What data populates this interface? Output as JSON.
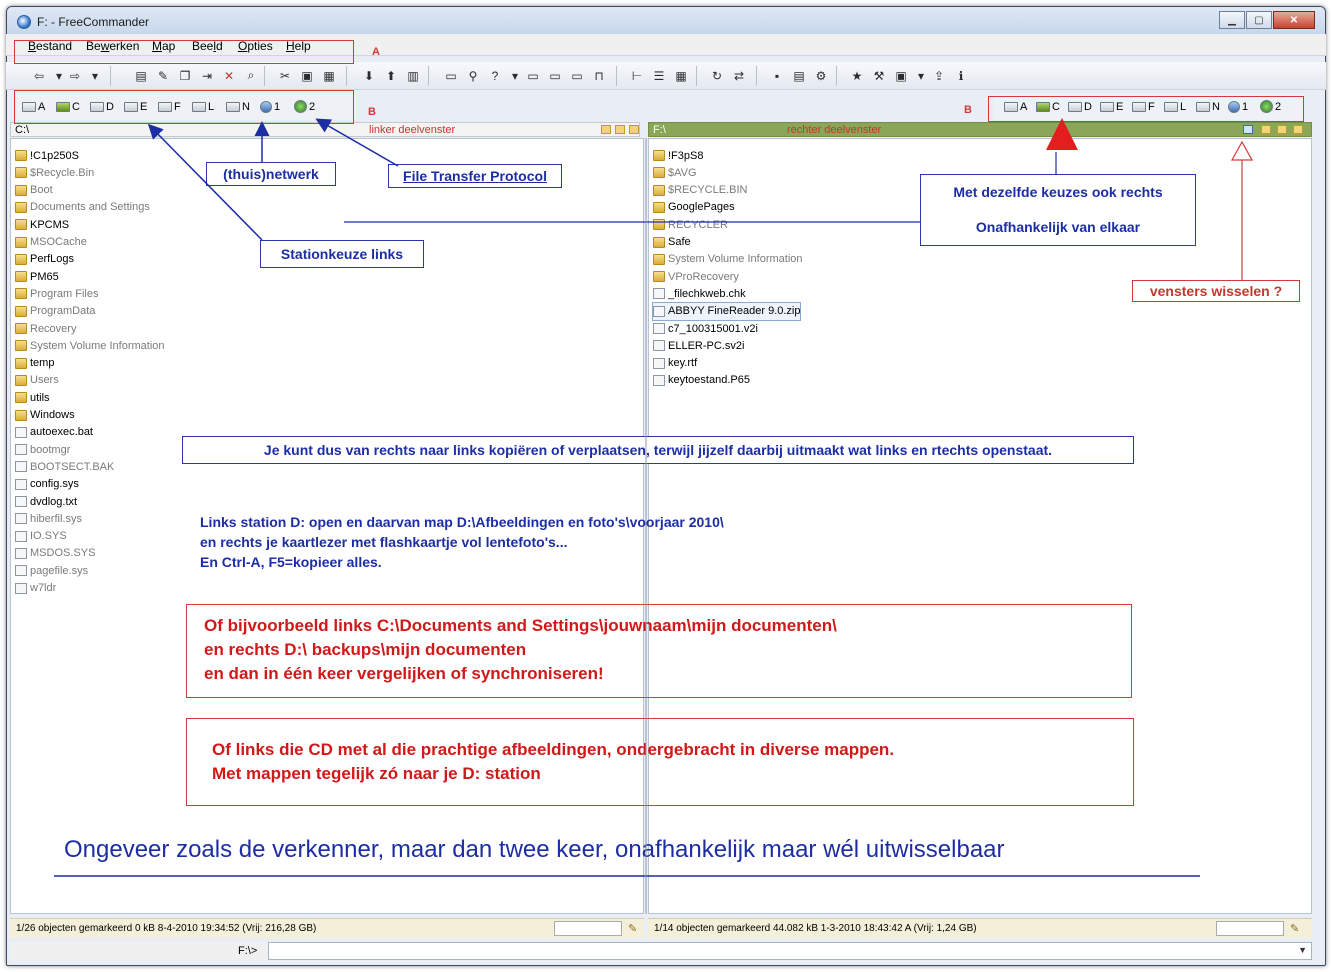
{
  "window": {
    "title": "F: - FreeCommander"
  },
  "menu": {
    "items": [
      {
        "pre": "",
        "u": "B",
        "post": "estand"
      },
      {
        "pre": "Be",
        "u": "w",
        "post": "erken"
      },
      {
        "pre": "",
        "u": "M",
        "post": "ap"
      },
      {
        "pre": "Bee",
        "u": "l",
        "post": "d"
      },
      {
        "pre": "",
        "u": "O",
        "post": "pties"
      },
      {
        "pre": "",
        "u": "H",
        "post": "elp"
      }
    ]
  },
  "drives": [
    "A",
    "C",
    "D",
    "E",
    "F",
    "L",
    "N",
    "1",
    "2"
  ],
  "left": {
    "path": "C:\\",
    "pane_label": "linker deelvenster",
    "files": [
      {
        "name": "!C1p250S",
        "type": "folder",
        "dim": false
      },
      {
        "name": "$Recycle.Bin",
        "type": "folder",
        "dim": true
      },
      {
        "name": "Boot",
        "type": "folder",
        "dim": true
      },
      {
        "name": "Documents and Settings",
        "type": "folder",
        "dim": true
      },
      {
        "name": "KPCMS",
        "type": "folder",
        "dim": false
      },
      {
        "name": "MSOCache",
        "type": "folder",
        "dim": true
      },
      {
        "name": "PerfLogs",
        "type": "folder",
        "dim": false
      },
      {
        "name": "PM65",
        "type": "folder",
        "dim": false
      },
      {
        "name": "Program Files",
        "type": "folder",
        "dim": true
      },
      {
        "name": "ProgramData",
        "type": "folder",
        "dim": true
      },
      {
        "name": "Recovery",
        "type": "folder",
        "dim": true
      },
      {
        "name": "System Volume Information",
        "type": "folder",
        "dim": true
      },
      {
        "name": "temp",
        "type": "folder",
        "dim": false
      },
      {
        "name": "Users",
        "type": "folder",
        "dim": true
      },
      {
        "name": "utils",
        "type": "folder",
        "dim": false
      },
      {
        "name": "Windows",
        "type": "folder",
        "dim": false
      },
      {
        "name": "autoexec.bat",
        "type": "file",
        "dim": false
      },
      {
        "name": "bootmgr",
        "type": "file",
        "dim": true
      },
      {
        "name": "BOOTSECT.BAK",
        "type": "file",
        "dim": true
      },
      {
        "name": "config.sys",
        "type": "file",
        "dim": false
      },
      {
        "name": "dvdlog.txt",
        "type": "file",
        "dim": false
      },
      {
        "name": "hiberfil.sys",
        "type": "file",
        "dim": true
      },
      {
        "name": "IO.SYS",
        "type": "file",
        "dim": true
      },
      {
        "name": "MSDOS.SYS",
        "type": "file",
        "dim": true
      },
      {
        "name": "pagefile.sys",
        "type": "file",
        "dim": true
      },
      {
        "name": "w7ldr",
        "type": "file",
        "dim": true
      }
    ],
    "status": "1/26 objecten gemarkeerd   0 kB  8-4-2010 19:34:52     (Vrij: 216,28 GB)"
  },
  "right": {
    "path": "F:\\",
    "pane_label": "rechter deelvenster",
    "files": [
      {
        "name": "!F3pS8",
        "type": "folder",
        "dim": false
      },
      {
        "name": "$AVG",
        "type": "folder",
        "dim": true
      },
      {
        "name": "$RECYCLE.BIN",
        "type": "folder",
        "dim": true
      },
      {
        "name": "GooglePages",
        "type": "folder",
        "dim": false
      },
      {
        "name": "RECYCLER",
        "type": "folder",
        "dim": true
      },
      {
        "name": "Safe",
        "type": "folder",
        "dim": false
      },
      {
        "name": "System Volume Information",
        "type": "folder",
        "dim": true
      },
      {
        "name": "VProRecovery",
        "type": "folder",
        "dim": true
      },
      {
        "name": "_filechkweb.chk",
        "type": "file",
        "dim": false
      },
      {
        "name": "ABBYY FineReader 9.0.zip",
        "type": "file",
        "dim": false,
        "selected": true
      },
      {
        "name": "c7_100315001.v2i",
        "type": "file",
        "dim": false
      },
      {
        "name": "ELLER-PC.sv2i",
        "type": "file",
        "dim": false
      },
      {
        "name": "key.rtf",
        "type": "file",
        "dim": false
      },
      {
        "name": "keytoestand.P65",
        "type": "file",
        "dim": false
      }
    ],
    "status": "1/14 objecten gemarkeerd   44.082 kB  1-3-2010 18:43:42  A   (Vrij: 1,24 GB)"
  },
  "cmd": {
    "prompt": "F:\\>"
  },
  "annotations": {
    "label_a": "A",
    "label_b": "B",
    "network": "(thuis)netwerk",
    "ftp": "File Transfer Protocol",
    "stationkeuze": "Stationkeuze links",
    "dezelfde": "Met dezelfde keuzes ook rechts",
    "onafhankelijk": "Onafhankelijk van elkaar",
    "vensters": "vensters wisselen ?",
    "kopieren": "Je kunt dus van rechts naar links kopiëren  of verplaatsen, terwijl jijzelf daarbij uitmaakt wat links en rtechts openstaat.",
    "links_station": [
      "Links station D: open en daarvan map D:\\Afbeeldingen en foto's\\voorjaar 2010\\",
      "en rechts je kaartlezer met flashkaartje vol lentefoto's...",
      "En Ctrl-A,  F5=kopieer alles."
    ],
    "of_bijvoorbeeld": [
      "Of bijvoorbeeld links C:\\Documents and Settings\\jouwnaam\\mijn documenten\\",
      "en rechts D:\\ backups\\mijn documenten",
      "en dan in één keer vergelijken of synchroniseren!"
    ],
    "of_links_cd": [
      "Of links die CD met al die prachtige afbeeldingen, ondergebracht in diverse mappen.",
      "Met mappen tegelijk zó naar je D:  station"
    ],
    "ongeveer": "Ongeveer zoals de verkenner,  maar dan twee     keer, onafhankelijk maar wél uitwisselbaar"
  },
  "colors": {
    "annotation_red": "#d43a3a",
    "annotation_blue": "#1d2ea5",
    "right_path_bg": "#8aa657"
  },
  "icons": [
    "app-icon",
    "back-icon",
    "forward-icon",
    "delete-icon",
    "copy-icon",
    "search-icon",
    "folder-icon",
    "file-icon",
    "swap-panes-icon"
  ]
}
